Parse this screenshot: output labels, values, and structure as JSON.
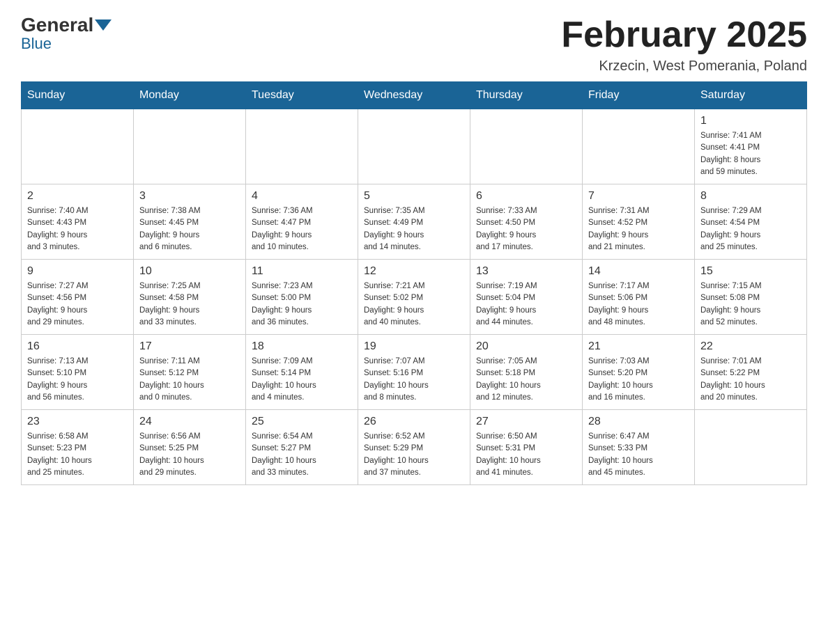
{
  "header": {
    "logo_general": "General",
    "logo_blue": "Blue",
    "title": "February 2025",
    "location": "Krzecin, West Pomerania, Poland"
  },
  "days_of_week": [
    "Sunday",
    "Monday",
    "Tuesday",
    "Wednesday",
    "Thursday",
    "Friday",
    "Saturday"
  ],
  "weeks": [
    [
      {
        "day": "",
        "info": ""
      },
      {
        "day": "",
        "info": ""
      },
      {
        "day": "",
        "info": ""
      },
      {
        "day": "",
        "info": ""
      },
      {
        "day": "",
        "info": ""
      },
      {
        "day": "",
        "info": ""
      },
      {
        "day": "1",
        "info": "Sunrise: 7:41 AM\nSunset: 4:41 PM\nDaylight: 8 hours\nand 59 minutes."
      }
    ],
    [
      {
        "day": "2",
        "info": "Sunrise: 7:40 AM\nSunset: 4:43 PM\nDaylight: 9 hours\nand 3 minutes."
      },
      {
        "day": "3",
        "info": "Sunrise: 7:38 AM\nSunset: 4:45 PM\nDaylight: 9 hours\nand 6 minutes."
      },
      {
        "day": "4",
        "info": "Sunrise: 7:36 AM\nSunset: 4:47 PM\nDaylight: 9 hours\nand 10 minutes."
      },
      {
        "day": "5",
        "info": "Sunrise: 7:35 AM\nSunset: 4:49 PM\nDaylight: 9 hours\nand 14 minutes."
      },
      {
        "day": "6",
        "info": "Sunrise: 7:33 AM\nSunset: 4:50 PM\nDaylight: 9 hours\nand 17 minutes."
      },
      {
        "day": "7",
        "info": "Sunrise: 7:31 AM\nSunset: 4:52 PM\nDaylight: 9 hours\nand 21 minutes."
      },
      {
        "day": "8",
        "info": "Sunrise: 7:29 AM\nSunset: 4:54 PM\nDaylight: 9 hours\nand 25 minutes."
      }
    ],
    [
      {
        "day": "9",
        "info": "Sunrise: 7:27 AM\nSunset: 4:56 PM\nDaylight: 9 hours\nand 29 minutes."
      },
      {
        "day": "10",
        "info": "Sunrise: 7:25 AM\nSunset: 4:58 PM\nDaylight: 9 hours\nand 33 minutes."
      },
      {
        "day": "11",
        "info": "Sunrise: 7:23 AM\nSunset: 5:00 PM\nDaylight: 9 hours\nand 36 minutes."
      },
      {
        "day": "12",
        "info": "Sunrise: 7:21 AM\nSunset: 5:02 PM\nDaylight: 9 hours\nand 40 minutes."
      },
      {
        "day": "13",
        "info": "Sunrise: 7:19 AM\nSunset: 5:04 PM\nDaylight: 9 hours\nand 44 minutes."
      },
      {
        "day": "14",
        "info": "Sunrise: 7:17 AM\nSunset: 5:06 PM\nDaylight: 9 hours\nand 48 minutes."
      },
      {
        "day": "15",
        "info": "Sunrise: 7:15 AM\nSunset: 5:08 PM\nDaylight: 9 hours\nand 52 minutes."
      }
    ],
    [
      {
        "day": "16",
        "info": "Sunrise: 7:13 AM\nSunset: 5:10 PM\nDaylight: 9 hours\nand 56 minutes."
      },
      {
        "day": "17",
        "info": "Sunrise: 7:11 AM\nSunset: 5:12 PM\nDaylight: 10 hours\nand 0 minutes."
      },
      {
        "day": "18",
        "info": "Sunrise: 7:09 AM\nSunset: 5:14 PM\nDaylight: 10 hours\nand 4 minutes."
      },
      {
        "day": "19",
        "info": "Sunrise: 7:07 AM\nSunset: 5:16 PM\nDaylight: 10 hours\nand 8 minutes."
      },
      {
        "day": "20",
        "info": "Sunrise: 7:05 AM\nSunset: 5:18 PM\nDaylight: 10 hours\nand 12 minutes."
      },
      {
        "day": "21",
        "info": "Sunrise: 7:03 AM\nSunset: 5:20 PM\nDaylight: 10 hours\nand 16 minutes."
      },
      {
        "day": "22",
        "info": "Sunrise: 7:01 AM\nSunset: 5:22 PM\nDaylight: 10 hours\nand 20 minutes."
      }
    ],
    [
      {
        "day": "23",
        "info": "Sunrise: 6:58 AM\nSunset: 5:23 PM\nDaylight: 10 hours\nand 25 minutes."
      },
      {
        "day": "24",
        "info": "Sunrise: 6:56 AM\nSunset: 5:25 PM\nDaylight: 10 hours\nand 29 minutes."
      },
      {
        "day": "25",
        "info": "Sunrise: 6:54 AM\nSunset: 5:27 PM\nDaylight: 10 hours\nand 33 minutes."
      },
      {
        "day": "26",
        "info": "Sunrise: 6:52 AM\nSunset: 5:29 PM\nDaylight: 10 hours\nand 37 minutes."
      },
      {
        "day": "27",
        "info": "Sunrise: 6:50 AM\nSunset: 5:31 PM\nDaylight: 10 hours\nand 41 minutes."
      },
      {
        "day": "28",
        "info": "Sunrise: 6:47 AM\nSunset: 5:33 PM\nDaylight: 10 hours\nand 45 minutes."
      },
      {
        "day": "",
        "info": ""
      }
    ]
  ]
}
